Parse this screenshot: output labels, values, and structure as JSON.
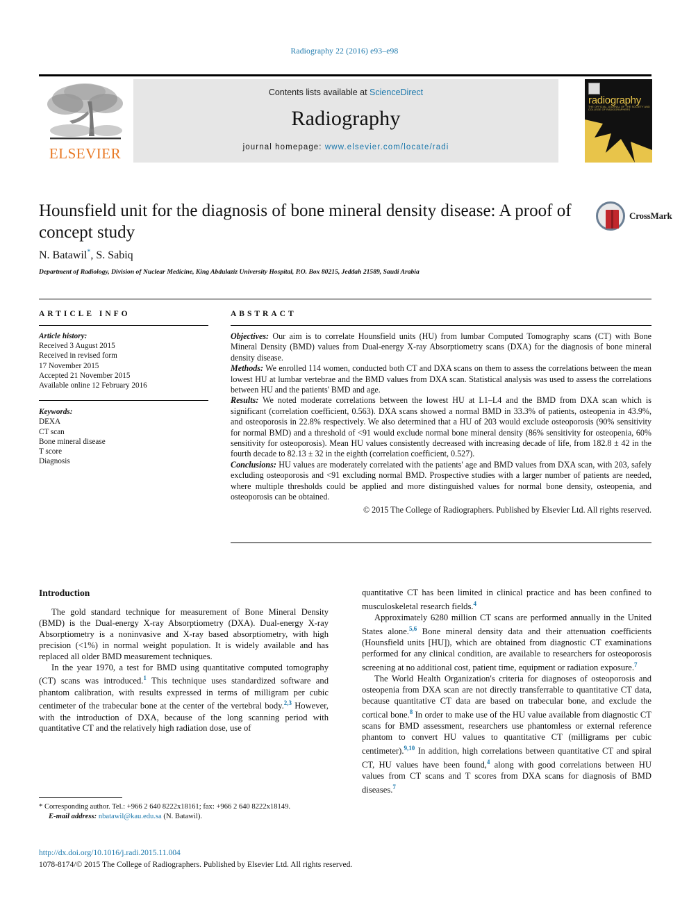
{
  "running_head": "Radiography 22 (2016) e93–e98",
  "masthead": {
    "publisher_logo_name": "elsevier-tree-logo",
    "publisher_name": "ELSEVIER",
    "contents_prefix": "Contents lists available at ",
    "contents_link": "ScienceDirect",
    "journal_name": "Radiography",
    "homepage_prefix": "journal homepage: ",
    "homepage_url": "www.elsevier.com/locate/radi",
    "cover_title": "radiography",
    "cover_subtitle": "THE OFFICIAL JOURNAL OF THE SOCIETY AND COLLEGE OF RADIOGRAPHERS"
  },
  "article": {
    "title": "Hounsfield unit for the diagnosis of bone mineral density disease: A proof of concept study",
    "authors": "N. Batawil, S. Sabiq",
    "author_marker": "*",
    "affiliation": "Department of Radiology, Division of Nuclear Medicine, King Abdulaziz University Hospital, P.O. Box 80215, Jeddah 21589, Saudi Arabia",
    "crossmark_label": "CrossMark"
  },
  "article_info": {
    "heading": "ARTICLE INFO",
    "history_label": "Article history:",
    "history": [
      "Received 3 August 2015",
      "Received in revised form",
      "17 November 2015",
      "Accepted 21 November 2015",
      "Available online 12 February 2016"
    ],
    "keywords_label": "Keywords:",
    "keywords": [
      "DEXA",
      "CT scan",
      "Bone mineral disease",
      "T score",
      "Diagnosis"
    ]
  },
  "abstract": {
    "heading": "ABSTRACT",
    "sections": [
      {
        "label": "Objectives:",
        "text": " Our aim is to correlate Hounsfield units (HU) from lumbar Computed Tomography scans (CT) with Bone Mineral Density (BMD) values from Dual-energy X-ray Absorptiometry scans (DXA) for the diagnosis of bone mineral density disease."
      },
      {
        "label": "Methods:",
        "text": " We enrolled 114 women, conducted both CT and DXA scans on them to assess the correlations between the mean lowest HU at lumbar vertebrae and the BMD values from DXA scan. Statistical analysis was used to assess the correlations between HU and the patients' BMD and age."
      },
      {
        "label": "Results:",
        "text": " We noted moderate correlations between the lowest HU at L1–L4 and the BMD from DXA scan which is significant (correlation coefficient, 0.563). DXA scans showed a normal BMD in 33.3% of patients, osteopenia in 43.9%, and osteoporosis in 22.8% respectively. We also determined that a HU of 203 would exclude osteoporosis (90% sensitivity for normal BMD) and a threshold of <91 would exclude normal bone mineral density (86% sensitivity for osteopenia, 60% sensitivity for osteoporosis). Mean HU values consistently decreased with increasing decade of life, from 182.8 ± 42 in the fourth decade to 82.13 ± 32 in the eighth (correlation coefficient, 0.527)."
      },
      {
        "label": "Conclusions:",
        "text": " HU values are moderately correlated with the patients' age and BMD values from DXA scan, with 203, safely excluding osteoporosis and <91 excluding normal BMD. Prospective studies with a larger number of patients are needed, where multiple thresholds could be applied and more distinguished values for normal bone density, osteopenia, and osteoporosis can be obtained."
      }
    ],
    "copyright": "© 2015 The College of Radiographers. Published by Elsevier Ltd. All rights reserved."
  },
  "body": {
    "heading": "Introduction",
    "left_paragraphs": [
      "The gold standard technique for measurement of Bone Mineral Density (BMD) is the Dual-energy X-ray Absorptiometry (DXA). Dual-energy X-ray Absorptiometry is a noninvasive and X-ray based absorptiometry, with high precision (<1%) in normal weight population. It is widely available and has replaced all older BMD measurement techniques.",
      "In the year 1970, a test for BMD using quantitative computed tomography (CT) scans was introduced.|1| This technique uses standardized software and phantom calibration, with results expressed in terms of milligram per cubic centimeter of the trabecular bone at the center of the vertebral body.|2,3| However, with the introduction of DXA, because of the long scanning period with quantitative CT and the relatively high radiation dose, use of"
    ],
    "right_paragraphs": [
      "quantitative CT has been limited in clinical practice and has been confined to musculoskeletal research fields.|4|",
      "Approximately 6280 million CT scans are performed annually in the United States alone.|5,6| Bone mineral density data and their attenuation coefficients (Hounsfield units [HU]), which are obtained from diagnostic CT examinations performed for any clinical condition, are available to researchers for osteoporosis screening at no additional cost, patient time, equipment or radiation exposure.|7|",
      "The World Health Organization's criteria for diagnoses of osteoporosis and osteopenia from DXA scan are not directly transferrable to quantitative CT data, because quantitative CT data are based on trabecular bone, and exclude the cortical bone.|8| In order to make use of the HU value available from diagnostic CT scans for BMD assessment, researchers use phantomless or external reference phantom to convert HU values to quantitative CT (milligrams per cubic centimeter).|9,10| In addition, high correlations between quantitative CT and spiral CT, HU values have been found,|4| along with good correlations between HU values from CT scans and T scores from DXA scans for diagnosis of BMD diseases.|7|"
    ]
  },
  "footnote": {
    "corresponding": "* Corresponding author. Tel.: +966 2 640 8222x18161; fax: +966 2 640 8222x18149.",
    "email_label": "E-mail address:",
    "email": "nbatawil@kau.edu.sa",
    "email_suffix": " (N. Batawil)."
  },
  "footer": {
    "doi": "http://dx.doi.org/10.1016/j.radi.2015.11.004",
    "issn_line": "1078-8174/© 2015 The College of Radiographers. Published by Elsevier Ltd. All rights reserved."
  },
  "colors": {
    "accent_blue": "#1a77ab",
    "elsevier_orange": "#e87722",
    "cover_yellow": "#e8c44a",
    "band_gray": "#e6e6e6"
  }
}
